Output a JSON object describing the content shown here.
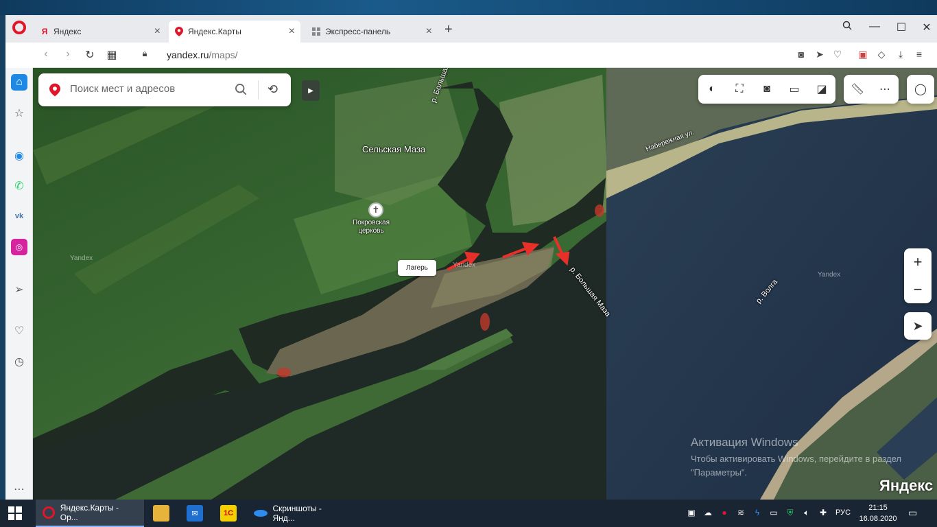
{
  "tabs": [
    {
      "label": "Яндекс",
      "favicon": "Я",
      "active": false
    },
    {
      "label": "Яндекс.Карты",
      "favicon": "map-pin",
      "active": true
    },
    {
      "label": "Экспресс-панель",
      "favicon": "grid",
      "active": false
    }
  ],
  "address": {
    "domain": "yandex.ru",
    "path": "/maps/"
  },
  "search": {
    "placeholder": "Поиск мест и адресов"
  },
  "map_labels": {
    "village": "Сельская Маза",
    "church": "Покровская\nцерковь",
    "camp": "Лагерь",
    "river_bolshaya_maza_top": "р. Большая",
    "river_bolshaya_maza": "р. Большая Маза",
    "river_volga": "р. Волга",
    "street": "Набережная ул.",
    "yandex_watermark_1": "Yandex",
    "yandex_watermark_2": "Yandex",
    "yandex_watermark_3": "Yandex"
  },
  "windows_activation": {
    "title": "Активация Windows",
    "text": "Чтобы активировать Windows, перейдите в раздел \"Параметры\"."
  },
  "map_logo": "Яндекс",
  "taskbar": {
    "apps": [
      {
        "label": "Яндекс.Карты - Op...",
        "active": true
      },
      {
        "label": "Скриншоты - Янд...",
        "active": false
      }
    ],
    "language": "РУС",
    "time": "21:15",
    "date": "16.08.2020"
  },
  "colors": {
    "opera_red": "#e0162b",
    "arrow_red": "#e8302a",
    "water": "#1f2a2a",
    "forest": "#2e5a2a"
  }
}
